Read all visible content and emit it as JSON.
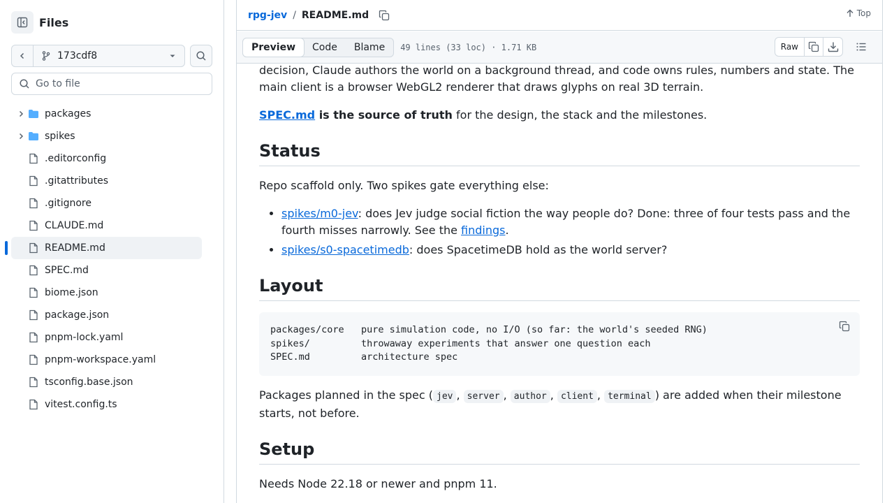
{
  "sidebar": {
    "title": "Files",
    "branch": "173cdf8",
    "goto_placeholder": "Go to file",
    "items": [
      {
        "label": "packages",
        "type": "folder"
      },
      {
        "label": "spikes",
        "type": "folder"
      },
      {
        "label": ".editorconfig",
        "type": "file"
      },
      {
        "label": ".gitattributes",
        "type": "file"
      },
      {
        "label": ".gitignore",
        "type": "file"
      },
      {
        "label": "CLAUDE.md",
        "type": "file"
      },
      {
        "label": "README.md",
        "type": "file",
        "active": true
      },
      {
        "label": "SPEC.md",
        "type": "file"
      },
      {
        "label": "biome.json",
        "type": "file"
      },
      {
        "label": "package.json",
        "type": "file"
      },
      {
        "label": "pnpm-lock.yaml",
        "type": "file"
      },
      {
        "label": "pnpm-workspace.yaml",
        "type": "file"
      },
      {
        "label": "tsconfig.base.json",
        "type": "file"
      },
      {
        "label": "vitest.config.ts",
        "type": "file"
      }
    ]
  },
  "header": {
    "repo": "rpg-jev",
    "separator": "/",
    "file": "README.md",
    "top_label": "Top"
  },
  "filebar": {
    "tabs": [
      "Preview",
      "Code",
      "Blame"
    ],
    "meta": "49 lines (33 loc) · 1.71 KB",
    "raw_label": "Raw"
  },
  "content": {
    "intro": "decision, Claude authors the world on a background thread, and code owns rules, numbers and state. The main client is a browser WebGL2 renderer that draws glyphs on real 3D terrain.",
    "spec_link": "SPEC.md",
    "spec_bold": " is the source of truth",
    "spec_rest": " for the design, the stack and the milestones.",
    "status_heading": "Status",
    "status_text": "Repo scaffold only. Two spikes gate everything else:",
    "bullet1_link": "spikes/m0-jev",
    "bullet1_text": ": does Jev judge social fiction the way people do? Done: three of four tests pass and the fourth misses narrowly. See the ",
    "bullet1_link2": "findings",
    "bullet1_end": ".",
    "bullet2_link": "spikes/s0-spacetimedb",
    "bullet2_text": ": does SpacetimeDB hold as the world server?",
    "layout_heading": "Layout",
    "code_block": "packages/core   pure simulation code, no I/O (so far: the world's seeded RNG)\nspikes/         throwaway experiments that answer one question each\nSPEC.md         architecture spec",
    "packages_pre": "Packages planned in the spec (",
    "pkg_jev": "jev",
    "pkg_server": "server",
    "pkg_author": "author",
    "pkg_client": "client",
    "pkg_terminal": "terminal",
    "comma": ", ",
    "packages_post": ") are added when their milestone starts, not before.",
    "setup_heading": "Setup",
    "setup_text": "Needs Node 22.18 or newer and pnpm 11."
  },
  "colors": {
    "accent": "#0969da",
    "folder": "#54aeff",
    "border": "#d1d9e0",
    "muted": "#59636e"
  }
}
